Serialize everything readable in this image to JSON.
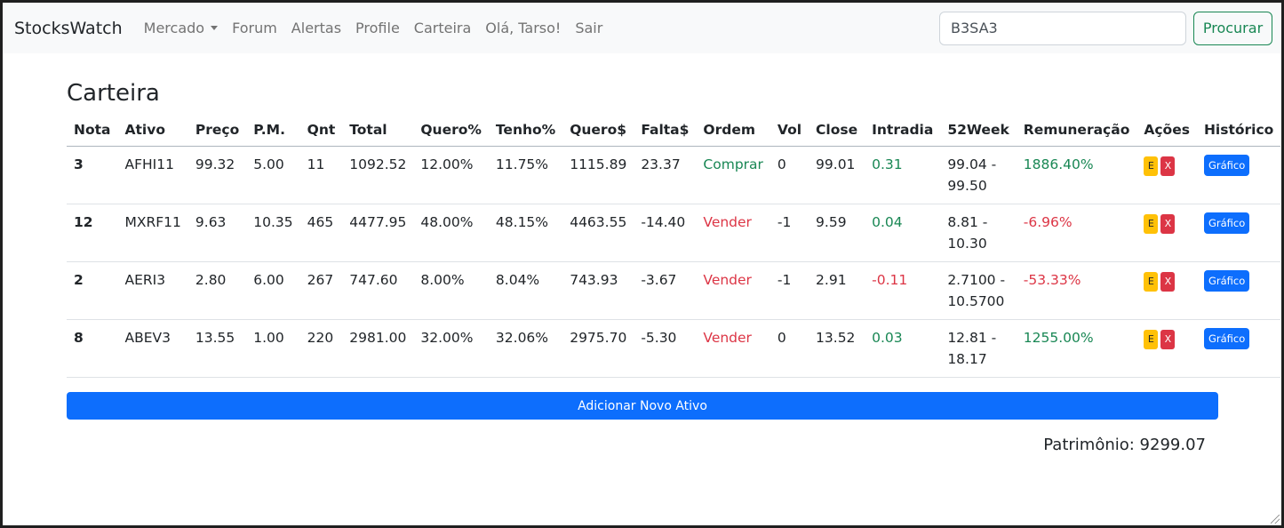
{
  "navbar": {
    "brand": "StocksWatch",
    "items": [
      {
        "label": "Mercado",
        "dropdown": true
      },
      {
        "label": "Forum"
      },
      {
        "label": "Alertas"
      },
      {
        "label": "Profile"
      },
      {
        "label": "Carteira"
      },
      {
        "label": "Olá, Tarso!"
      },
      {
        "label": "Sair"
      }
    ],
    "search_value": "B3SA3",
    "search_button": "Procurar"
  },
  "main": {
    "title": "Carteira",
    "columns": [
      "Nota",
      "Ativo",
      "Preço",
      "P.M.",
      "Qnt",
      "Total",
      "Quero%",
      "Tenho%",
      "Quero$",
      "Falta$",
      "Ordem",
      "Vol",
      "Close",
      "Intradia",
      "52Week",
      "Remuneração",
      "Ações",
      "Histórico"
    ],
    "rows": [
      {
        "nota": "3",
        "ativo": "AFHI11",
        "preco": "99.32",
        "pm": "5.00",
        "qnt": "11",
        "total": "1092.52",
        "quero_pct": "12.00%",
        "tenho_pct": "11.75%",
        "quero_val": "1115.89",
        "falta": "23.37",
        "ordem": "Comprar",
        "vol": "0",
        "close": "99.01",
        "intradia": "0.31",
        "week52": "99.04 - 99.50",
        "remuneracao": "1886.40%",
        "edit": "E",
        "delete": "X",
        "grafico": "Gráfico"
      },
      {
        "nota": "12",
        "ativo": "MXRF11",
        "preco": "9.63",
        "pm": "10.35",
        "qnt": "465",
        "total": "4477.95",
        "quero_pct": "48.00%",
        "tenho_pct": "48.15%",
        "quero_val": "4463.55",
        "falta": "-14.40",
        "ordem": "Vender",
        "vol": "-1",
        "close": "9.59",
        "intradia": "0.04",
        "week52": "8.81 - 10.30",
        "remuneracao": "-6.96%",
        "edit": "E",
        "delete": "X",
        "grafico": "Gráfico"
      },
      {
        "nota": "2",
        "ativo": "AERI3",
        "preco": "2.80",
        "pm": "6.00",
        "qnt": "267",
        "total": "747.60",
        "quero_pct": "8.00%",
        "tenho_pct": "8.04%",
        "quero_val": "743.93",
        "falta": "-3.67",
        "ordem": "Vender",
        "vol": "-1",
        "close": "2.91",
        "intradia": "-0.11",
        "week52": "2.7100 - 10.5700",
        "remuneracao": "-53.33%",
        "edit": "E",
        "delete": "X",
        "grafico": "Gráfico"
      },
      {
        "nota": "8",
        "ativo": "ABEV3",
        "preco": "13.55",
        "pm": "1.00",
        "qnt": "220",
        "total": "2981.00",
        "quero_pct": "32.00%",
        "tenho_pct": "32.06%",
        "quero_val": "2975.70",
        "falta": "-5.30",
        "ordem": "Vender",
        "vol": "0",
        "close": "13.52",
        "intradia": "0.03",
        "week52": "12.81 - 18.17",
        "remuneracao": "1255.00%",
        "edit": "E",
        "delete": "X",
        "grafico": "Gráfico"
      }
    ],
    "add_button": "Adicionar Novo Ativo",
    "patrimonio": "Patrimônio: 9299.07"
  },
  "colors": {
    "green": "#198754",
    "red": "#dc3545",
    "primary": "#0d6efd",
    "warning": "#ffc107"
  }
}
